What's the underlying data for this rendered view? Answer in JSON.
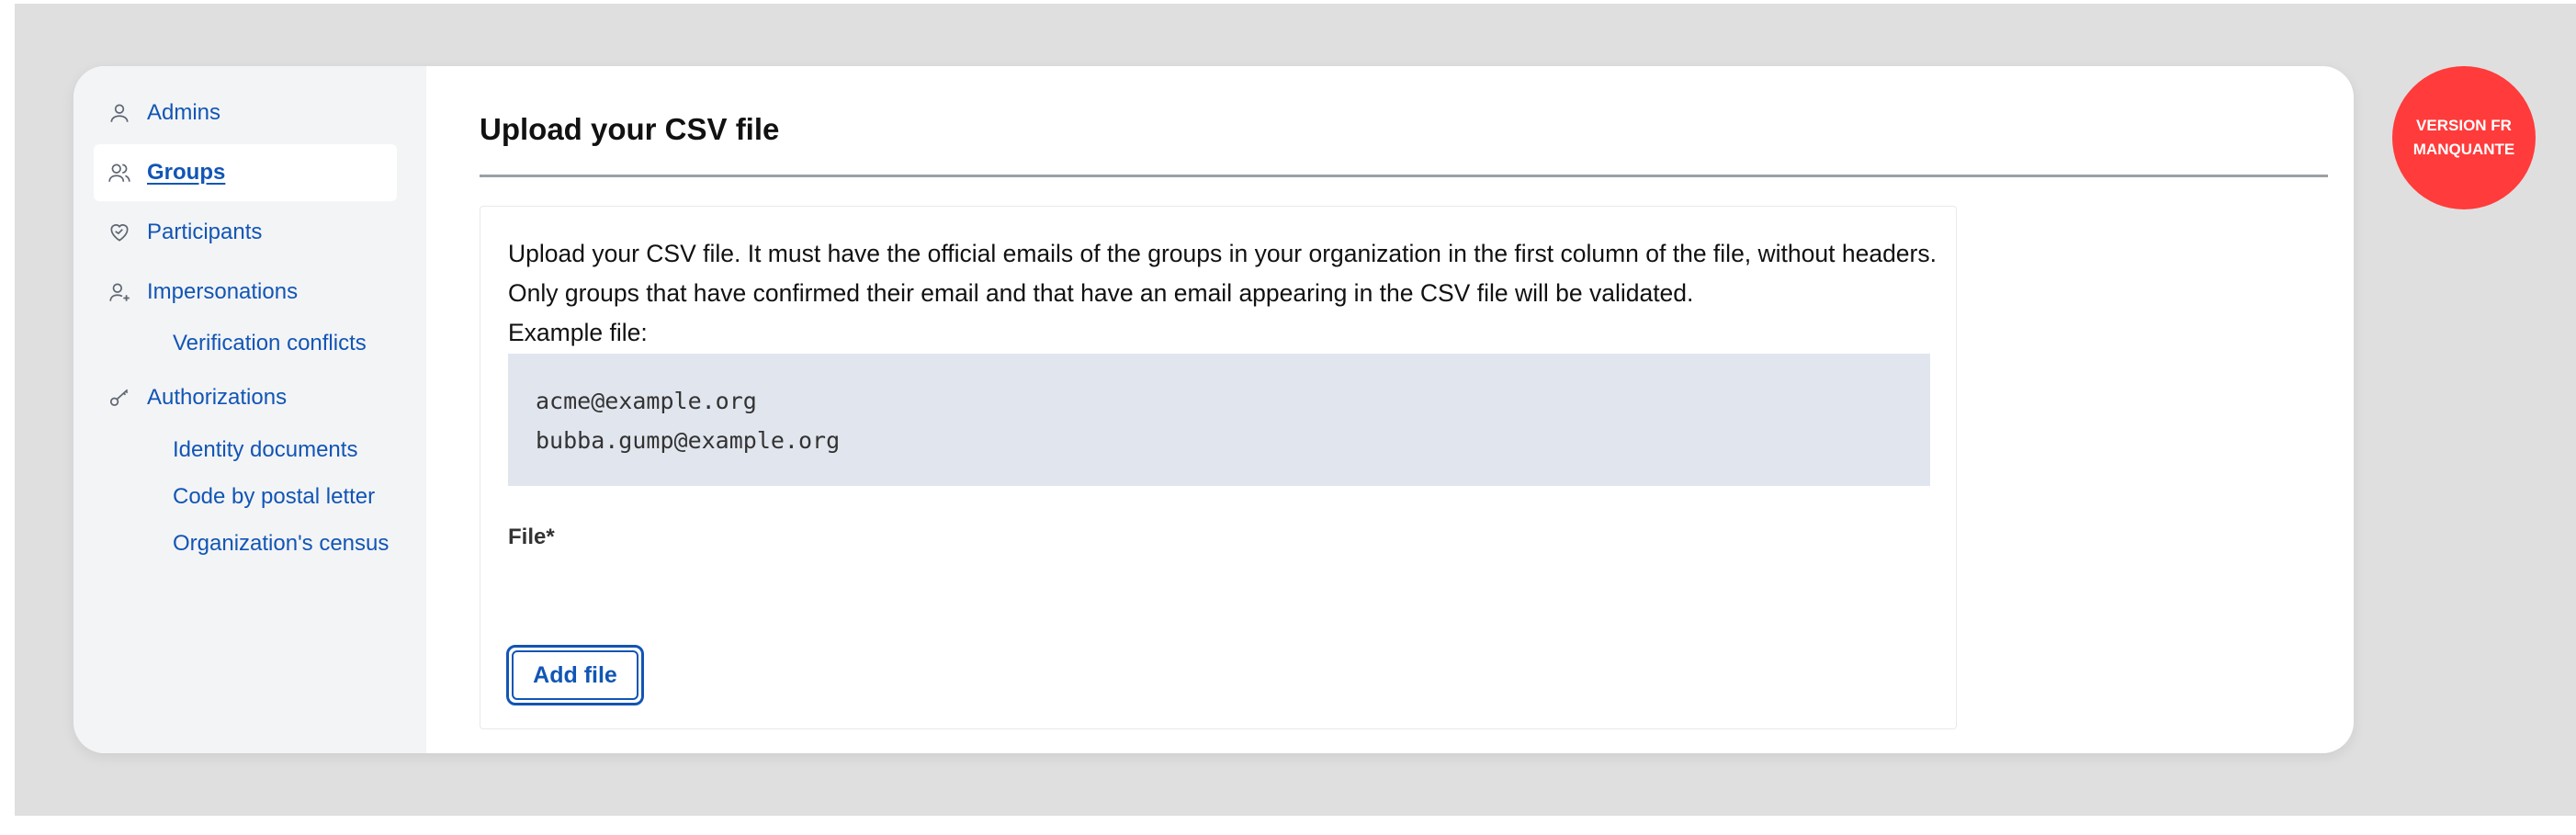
{
  "sidebar": {
    "items": [
      {
        "label": "Admins",
        "icon": "user-icon"
      },
      {
        "label": "Groups",
        "icon": "users-icon",
        "active": true
      },
      {
        "label": "Participants",
        "icon": "heart-handshake-icon"
      },
      {
        "label": "Impersonations",
        "icon": "user-add-icon"
      },
      {
        "label": "Authorizations",
        "icon": "key-icon"
      }
    ],
    "sub_items": {
      "impersonations": [
        "Verification conflicts"
      ],
      "authorizations": [
        "Identity documents",
        "Code by postal letter",
        "Organization's census"
      ]
    }
  },
  "main": {
    "title": "Upload your CSV file",
    "description": "Upload your CSV file. It must have the official emails of the groups in your organization in the first column of the file, without headers. Only groups that have confirmed their email and that have an email appearing in the CSV file will be validated.",
    "example_label": "Example file:",
    "example_lines": [
      "acme@example.org",
      "bubba.gump@example.org"
    ],
    "file_label": "File*",
    "add_file_label": "Add file"
  },
  "badge": {
    "text": "VERSION FR MANQUANTE",
    "color": "#ff3b3b"
  },
  "colors": {
    "link": "#1155b5",
    "sidebar_bg": "#f3f4f6",
    "code_bg": "#e1e5ee"
  }
}
